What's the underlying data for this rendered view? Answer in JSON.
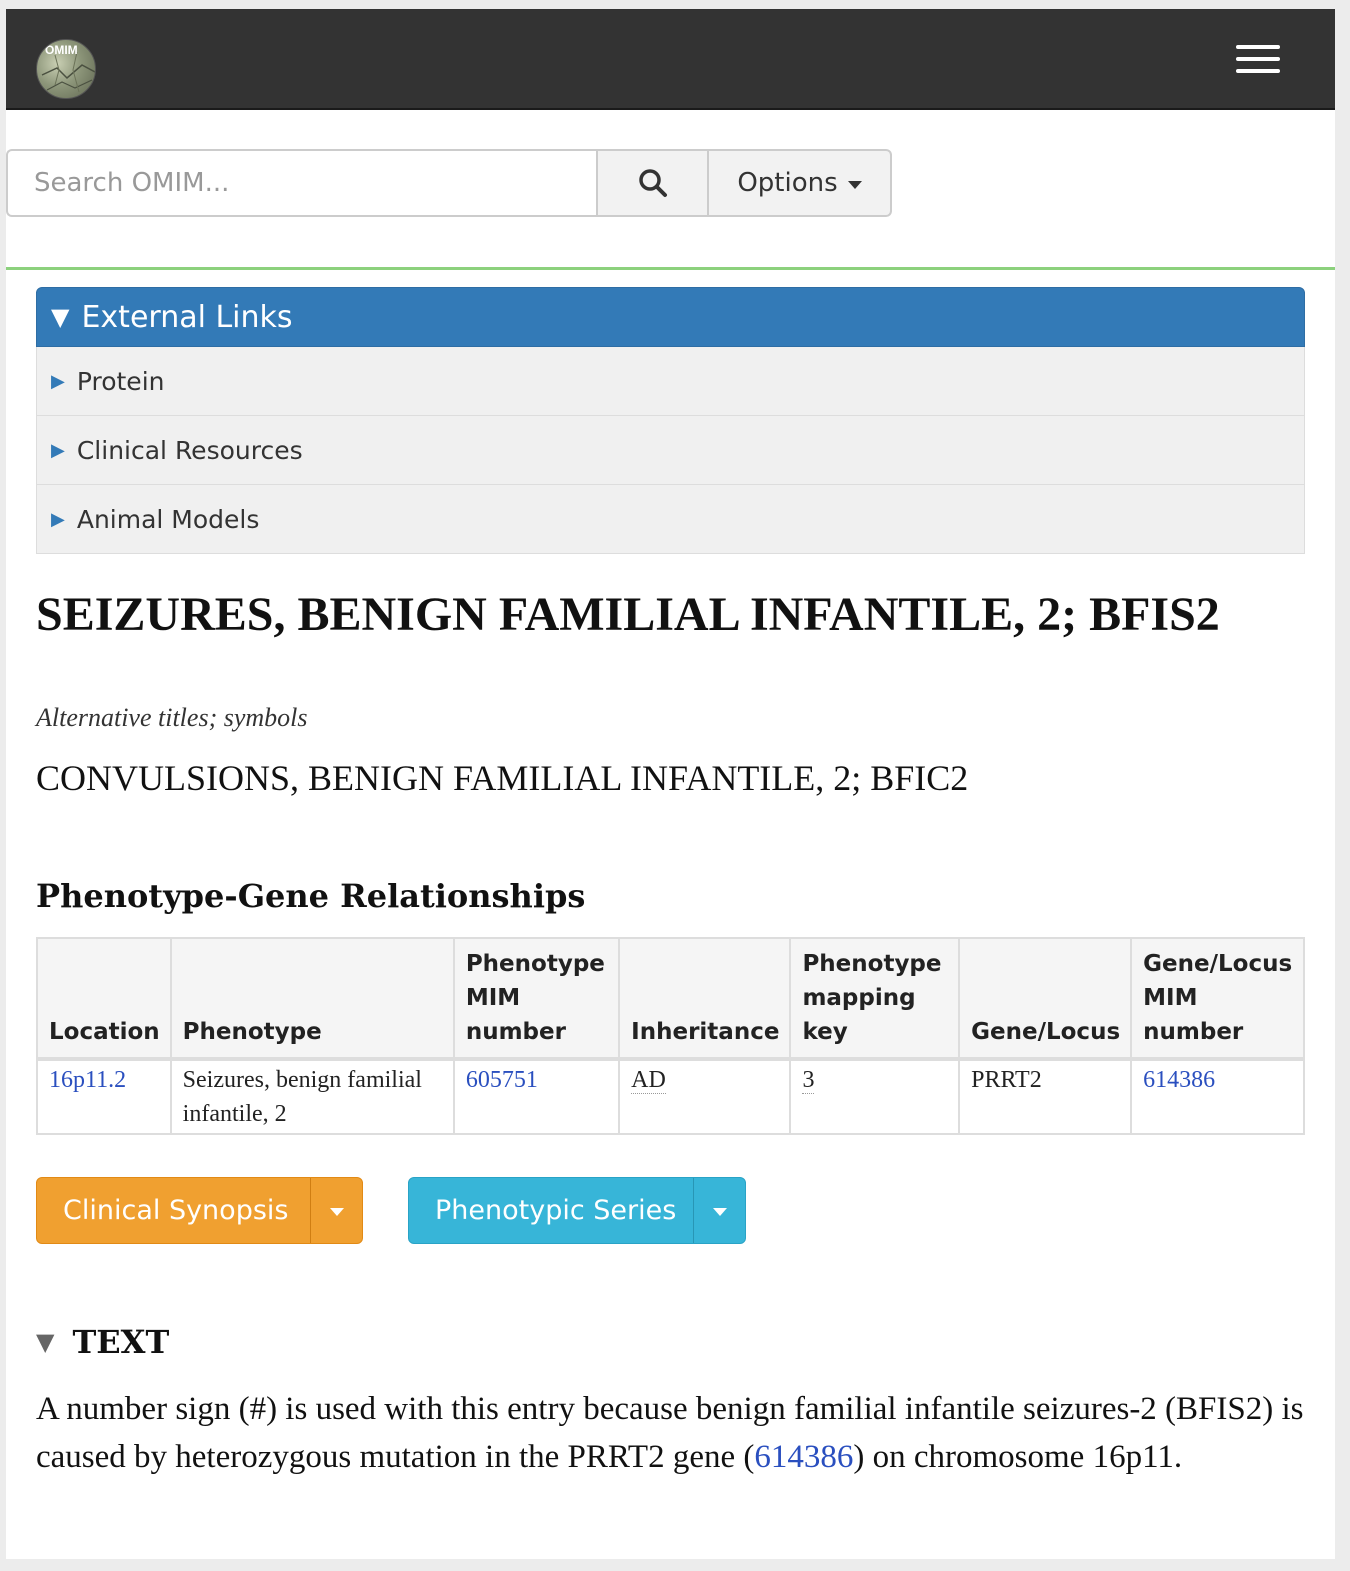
{
  "navbar": {
    "logo_text": "OMIM",
    "logo_icon": "omim-logo",
    "menu_icon": "hamburger-menu-icon"
  },
  "search": {
    "placeholder": "Search OMIM...",
    "button_icon": "search-icon",
    "options_label": "Options"
  },
  "external_links": {
    "header": "External Links",
    "items": [
      {
        "label": "Protein"
      },
      {
        "label": "Clinical Resources"
      },
      {
        "label": "Animal Models"
      }
    ]
  },
  "entry": {
    "title": "SEIZURES, BENIGN FAMILIAL INFANTILE, 2; BFIS2",
    "alt_label": "Alternative titles; symbols",
    "alt_title": "CONVULSIONS, BENIGN FAMILIAL INFANTILE, 2; BFIC2"
  },
  "phenotype_gene": {
    "heading": "Phenotype-Gene Relationships",
    "columns": [
      "Location",
      "Phenotype",
      "Phenotype MIM number",
      "Inheritance",
      "Phenotype mapping key",
      "Gene/Locus",
      "Gene/Locus MIM number"
    ],
    "rows": [
      {
        "location": "16p11.2",
        "phenotype": "Seizures, benign familial infantile, 2",
        "phenotype_mim": "605751",
        "inheritance": "AD",
        "mapping_key": "3",
        "gene_locus": "PRRT2",
        "gene_mim": "614386"
      }
    ]
  },
  "actions": {
    "clinical_synopsis": "Clinical Synopsis",
    "phenotypic_series": "Phenotypic Series"
  },
  "text_section": {
    "heading": "TEXT",
    "part1": "A number sign (#) is used with this entry because benign familial infantile seizures-2 (BFIS2) is caused by heterozygous mutation in the PRRT2 gene (",
    "link": "614386",
    "part2": ") on chromosome 16p11."
  },
  "colors": {
    "navbar": "#333333",
    "primary": "#337ab7",
    "warning": "#f0a030",
    "info": "#37b5d8",
    "link": "#2a4fbf",
    "rule": "#8cd17d"
  }
}
